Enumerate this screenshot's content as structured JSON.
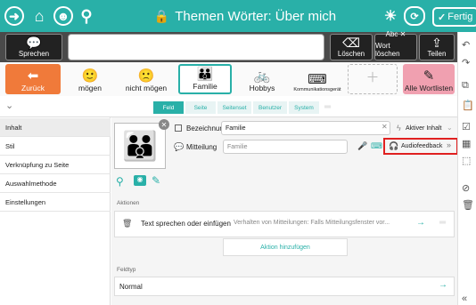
{
  "title": "Themen Wörter: Über mich",
  "fertig": "Fertig",
  "toolbar": {
    "sprechen": "Sprechen",
    "loeschen": "Löschen",
    "wort_loeschen": "Wort löschen",
    "teilen": "Teilen"
  },
  "cells": {
    "zurueck": "Zurück",
    "moegen": "mögen",
    "nicht_moegen": "nicht mögen",
    "familie": "Familie",
    "hobbys": "Hobbys",
    "kommunikationsgeraet": "Kommunikationsgerät",
    "alle_wortlisten": "Alle Wortlisten"
  },
  "tabs": [
    "Feld",
    "Seite",
    "Seitenset",
    "Benutzer",
    "System"
  ],
  "left_menu": [
    "Inhalt",
    "Stil",
    "Verknüpfung zu Seite",
    "Auswahlmethode",
    "Einstellungen"
  ],
  "form": {
    "bezeichnung_label": "Bezeichnung",
    "bezeichnung_value": "Familie",
    "mitteilung_label": "Mitteilung",
    "mitteilung_placeholder": "Familie",
    "aktiver_inhalt": "Aktiver Inhalt",
    "audiofeedback": "Audiofeedback",
    "aktionen": "Aktionen",
    "action_title": "Text sprechen oder einfügen",
    "action_desc": "Verhalten von Mitteilungen: Falls Mitteilungsfenster vor...",
    "aktion_hinzufuegen": "Aktion hinzufügen",
    "feldtyp": "Feldtyp",
    "feldtyp_value": "Normal"
  },
  "colors": {
    "teal": "#29b0a8",
    "dark": "#4a4a4a",
    "red_highlight": "#e02020",
    "orange": "#f07a3a",
    "pink": "#f0a0b0"
  }
}
